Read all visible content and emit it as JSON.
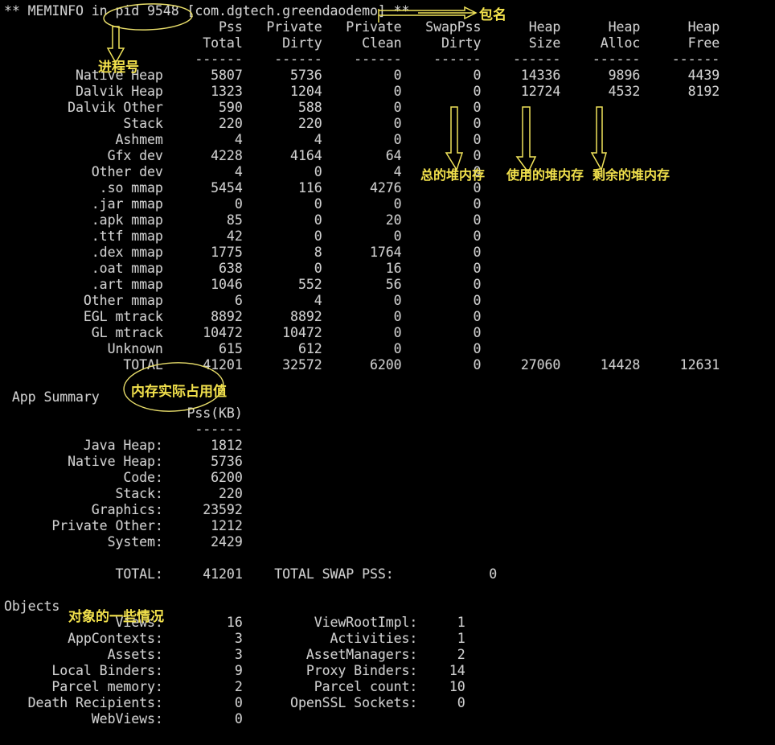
{
  "terminal": {
    "background": "#000000",
    "text_color": "#cfcfcf",
    "annotation_color": "#f2e14c",
    "header_line": "** MEMINFO in pid 9548 [com.dgtech.greendaodemo] **",
    "process_id": "9548",
    "package_name": "com.dgtech.greendaodemo"
  },
  "meminfo": {
    "columns": [
      {
        "line1": "",
        "line2": ""
      },
      {
        "line1": "Pss",
        "line2": "Total"
      },
      {
        "line1": "Private",
        "line2": "Dirty"
      },
      {
        "line1": "Private",
        "line2": "Clean"
      },
      {
        "line1": "SwapPss",
        "line2": "Dirty"
      },
      {
        "line1": "Heap",
        "line2": "Size"
      },
      {
        "line1": "Heap",
        "line2": "Alloc"
      },
      {
        "line1": "Heap",
        "line2": "Free"
      }
    ],
    "rule": "------",
    "rows": [
      {
        "label": "Native Heap",
        "pss_total": "5807",
        "private_dirty": "5736",
        "private_clean": "0",
        "swappss_dirty": "0",
        "heap_size": "14336",
        "heap_alloc": "9896",
        "heap_free": "4439"
      },
      {
        "label": "Dalvik Heap",
        "pss_total": "1323",
        "private_dirty": "1204",
        "private_clean": "0",
        "swappss_dirty": "0",
        "heap_size": "12724",
        "heap_alloc": "4532",
        "heap_free": "8192"
      },
      {
        "label": "Dalvik Other",
        "pss_total": "590",
        "private_dirty": "588",
        "private_clean": "0",
        "swappss_dirty": "0",
        "heap_size": "",
        "heap_alloc": "",
        "heap_free": ""
      },
      {
        "label": "Stack",
        "pss_total": "220",
        "private_dirty": "220",
        "private_clean": "0",
        "swappss_dirty": "0",
        "heap_size": "",
        "heap_alloc": "",
        "heap_free": ""
      },
      {
        "label": "Ashmem",
        "pss_total": "4",
        "private_dirty": "4",
        "private_clean": "0",
        "swappss_dirty": "0",
        "heap_size": "",
        "heap_alloc": "",
        "heap_free": ""
      },
      {
        "label": "Gfx dev",
        "pss_total": "4228",
        "private_dirty": "4164",
        "private_clean": "64",
        "swappss_dirty": "0",
        "heap_size": "",
        "heap_alloc": "",
        "heap_free": ""
      },
      {
        "label": "Other dev",
        "pss_total": "4",
        "private_dirty": "0",
        "private_clean": "4",
        "swappss_dirty": "0",
        "heap_size": "",
        "heap_alloc": "",
        "heap_free": ""
      },
      {
        "label": ".so mmap",
        "pss_total": "5454",
        "private_dirty": "116",
        "private_clean": "4276",
        "swappss_dirty": "0",
        "heap_size": "",
        "heap_alloc": "",
        "heap_free": ""
      },
      {
        "label": ".jar mmap",
        "pss_total": "0",
        "private_dirty": "0",
        "private_clean": "0",
        "swappss_dirty": "0",
        "heap_size": "",
        "heap_alloc": "",
        "heap_free": ""
      },
      {
        "label": ".apk mmap",
        "pss_total": "85",
        "private_dirty": "0",
        "private_clean": "20",
        "swappss_dirty": "0",
        "heap_size": "",
        "heap_alloc": "",
        "heap_free": ""
      },
      {
        "label": ".ttf mmap",
        "pss_total": "42",
        "private_dirty": "0",
        "private_clean": "0",
        "swappss_dirty": "0",
        "heap_size": "",
        "heap_alloc": "",
        "heap_free": ""
      },
      {
        "label": ".dex mmap",
        "pss_total": "1775",
        "private_dirty": "8",
        "private_clean": "1764",
        "swappss_dirty": "0",
        "heap_size": "",
        "heap_alloc": "",
        "heap_free": ""
      },
      {
        "label": ".oat mmap",
        "pss_total": "638",
        "private_dirty": "0",
        "private_clean": "16",
        "swappss_dirty": "0",
        "heap_size": "",
        "heap_alloc": "",
        "heap_free": ""
      },
      {
        "label": ".art mmap",
        "pss_total": "1046",
        "private_dirty": "552",
        "private_clean": "56",
        "swappss_dirty": "0",
        "heap_size": "",
        "heap_alloc": "",
        "heap_free": ""
      },
      {
        "label": "Other mmap",
        "pss_total": "6",
        "private_dirty": "4",
        "private_clean": "0",
        "swappss_dirty": "0",
        "heap_size": "",
        "heap_alloc": "",
        "heap_free": ""
      },
      {
        "label": "EGL mtrack",
        "pss_total": "8892",
        "private_dirty": "8892",
        "private_clean": "0",
        "swappss_dirty": "0",
        "heap_size": "",
        "heap_alloc": "",
        "heap_free": ""
      },
      {
        "label": "GL mtrack",
        "pss_total": "10472",
        "private_dirty": "10472",
        "private_clean": "0",
        "swappss_dirty": "0",
        "heap_size": "",
        "heap_alloc": "",
        "heap_free": ""
      },
      {
        "label": "Unknown",
        "pss_total": "615",
        "private_dirty": "612",
        "private_clean": "0",
        "swappss_dirty": "0",
        "heap_size": "",
        "heap_alloc": "",
        "heap_free": ""
      },
      {
        "label": "TOTAL",
        "pss_total": "41201",
        "private_dirty": "32572",
        "private_clean": "6200",
        "swappss_dirty": "0",
        "heap_size": "27060",
        "heap_alloc": "14428",
        "heap_free": "12631"
      }
    ]
  },
  "app_summary": {
    "title": "App Summary",
    "column_header": "Pss(KB)",
    "rule": "------",
    "rows": [
      {
        "label": "Java Heap:",
        "value": "1812"
      },
      {
        "label": "Native Heap:",
        "value": "5736"
      },
      {
        "label": "Code:",
        "value": "6200"
      },
      {
        "label": "Stack:",
        "value": "220"
      },
      {
        "label": "Graphics:",
        "value": "23592"
      },
      {
        "label": "Private Other:",
        "value": "1212"
      },
      {
        "label": "System:",
        "value": "2429"
      }
    ],
    "total_label": "TOTAL:",
    "total_value": "41201",
    "swap_label": "TOTAL SWAP PSS:",
    "swap_value": "0"
  },
  "objects": {
    "title": "Objects",
    "rows": [
      {
        "left_label": "Views:",
        "left_value": "16",
        "right_label": "ViewRootImpl:",
        "right_value": "1"
      },
      {
        "left_label": "AppContexts:",
        "left_value": "3",
        "right_label": "Activities:",
        "right_value": "1"
      },
      {
        "left_label": "Assets:",
        "left_value": "3",
        "right_label": "AssetManagers:",
        "right_value": "2"
      },
      {
        "left_label": "Local Binders:",
        "left_value": "9",
        "right_label": "Proxy Binders:",
        "right_value": "14"
      },
      {
        "left_label": "Parcel memory:",
        "left_value": "2",
        "right_label": "Parcel count:",
        "right_value": "10"
      },
      {
        "left_label": "Death Recipients:",
        "left_value": "0",
        "right_label": "OpenSSL Sockets:",
        "right_value": "0"
      },
      {
        "left_label": "WebViews:",
        "left_value": "0",
        "right_label": "",
        "right_value": ""
      }
    ]
  },
  "annotations": {
    "pid_note": "进程号",
    "package_note": "包名",
    "heap_size_note": "总的堆内存",
    "heap_alloc_note": "使用的堆内存",
    "heap_free_note": "剩余的堆内存",
    "total_pss_note": "内存实际占用值",
    "objects_note": "对象的一些情况"
  }
}
